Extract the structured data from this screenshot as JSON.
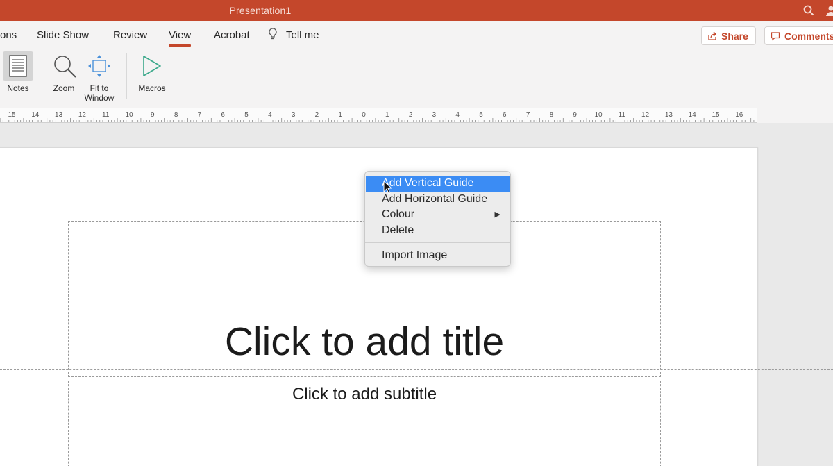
{
  "window": {
    "title": "Presentation1"
  },
  "tabs": [
    {
      "label": "ons",
      "active": false
    },
    {
      "label": "Slide Show",
      "active": false
    },
    {
      "label": "Review",
      "active": false
    },
    {
      "label": "View",
      "active": true
    },
    {
      "label": "Acrobat",
      "active": false
    },
    {
      "label": "Tell me",
      "active": false
    }
  ],
  "header_buttons": {
    "share": "Share",
    "comments": "Comments"
  },
  "ribbon": {
    "notes": "Notes",
    "zoom": "Zoom",
    "fit_line1": "Fit to",
    "fit_line2": "Window",
    "macros": "Macros"
  },
  "ruler": {
    "labels_left": [
      "15",
      "14",
      "13",
      "12",
      "11",
      "10",
      "9",
      "8",
      "7",
      "6",
      "5",
      "4",
      "3",
      "2",
      "1",
      "0"
    ],
    "labels_right": [
      "1",
      "2",
      "3",
      "4",
      "5",
      "6",
      "7",
      "8",
      "9",
      "10",
      "11",
      "12",
      "13",
      "14",
      "15",
      "16"
    ]
  },
  "slide": {
    "title_placeholder": "Click to add title",
    "subtitle_placeholder": "Click to add subtitle"
  },
  "context_menu": {
    "items": [
      {
        "label": "Add Vertical Guide",
        "highlighted": true
      },
      {
        "label": "Add Horizontal Guide",
        "highlighted": false
      },
      {
        "label": "Colour",
        "submenu": true
      },
      {
        "label": "Delete",
        "highlighted": false
      },
      {
        "label": "Import Image",
        "highlighted": false
      }
    ]
  },
  "colors": {
    "accent": "#c4472b",
    "highlight": "#3b8cf4"
  }
}
